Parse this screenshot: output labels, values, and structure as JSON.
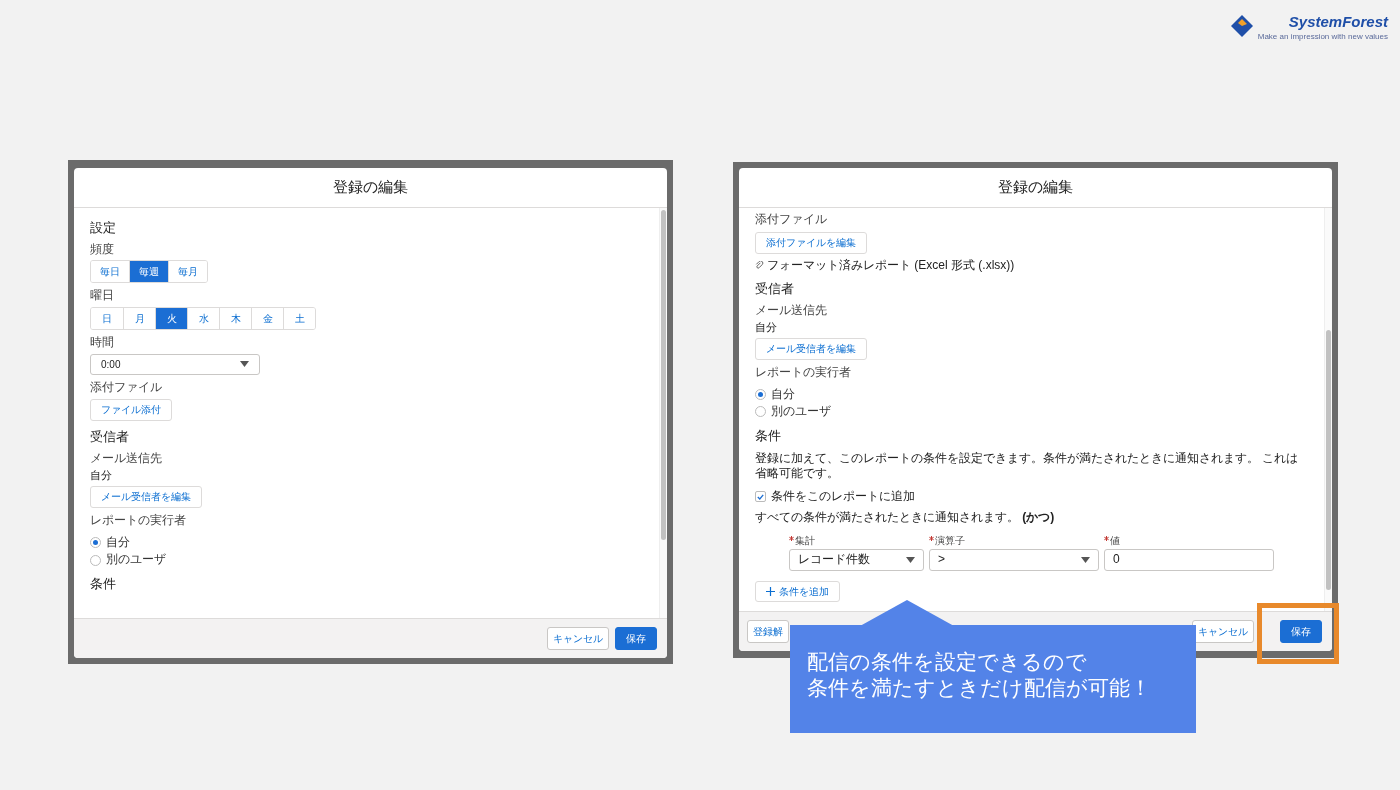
{
  "logo": {
    "name": "SystemForest",
    "tagline": "Make an impression with new values"
  },
  "screenshots": [
    {
      "dialog_title": "登録の編集",
      "items": [
        {
          "kind": "heading",
          "text": "設定"
        },
        {
          "kind": "label",
          "text": "頻度"
        },
        {
          "kind": "segmented",
          "options": [
            {
              "label": "毎日",
              "selected": false
            },
            {
              "label": "毎週",
              "selected": true
            },
            {
              "label": "毎月",
              "selected": false
            }
          ]
        },
        {
          "kind": "label",
          "text": "曜日"
        },
        {
          "kind": "segmented",
          "options": [
            {
              "label": "日",
              "selected": false
            },
            {
              "label": "月",
              "selected": false
            },
            {
              "label": "火",
              "selected": true
            },
            {
              "label": "水",
              "selected": false
            },
            {
              "label": "木",
              "selected": false
            },
            {
              "label": "金",
              "selected": false
            },
            {
              "label": "土",
              "selected": false
            }
          ]
        },
        {
          "kind": "label",
          "text": "時間"
        },
        {
          "kind": "select",
          "value": "0:00"
        },
        {
          "kind": "label",
          "text": "添付ファイル"
        },
        {
          "kind": "button",
          "text": "ファイル添付"
        },
        {
          "kind": "heading",
          "text": "受信者"
        },
        {
          "kind": "label",
          "text": "メール送信先"
        },
        {
          "kind": "value",
          "text": "自分"
        },
        {
          "kind": "button",
          "text": "メール受信者を編集"
        },
        {
          "kind": "label",
          "text": "レポートの実行者"
        },
        {
          "kind": "radios",
          "options": [
            {
              "label": "自分",
              "selected": true
            },
            {
              "label": "別のユーザ",
              "selected": false
            }
          ]
        },
        {
          "kind": "heading",
          "text": "条件"
        }
      ],
      "footer_right": [
        {
          "label": "キャンセル",
          "kind": "neutral"
        },
        {
          "label": "保存",
          "kind": "brand"
        }
      ]
    },
    {
      "dialog_title": "登録の編集",
      "items": [
        {
          "kind": "label",
          "text": "添付ファイル"
        },
        {
          "kind": "button",
          "text": "添付ファイルを編集"
        },
        {
          "kind": "attachment",
          "text": "フォーマット済みレポート (Excel 形式 (.xlsx))"
        },
        {
          "kind": "heading",
          "text": "受信者"
        },
        {
          "kind": "label",
          "text": "メール送信先"
        },
        {
          "kind": "value",
          "text": "自分"
        },
        {
          "kind": "button",
          "text": "メール受信者を編集"
        },
        {
          "kind": "label",
          "text": "レポートの実行者"
        },
        {
          "kind": "radios",
          "options": [
            {
              "label": "自分",
              "selected": true
            },
            {
              "label": "別のユーザ",
              "selected": false
            }
          ]
        },
        {
          "kind": "heading",
          "text": "条件"
        },
        {
          "kind": "paragraph",
          "text": "登録に加えて、このレポートの条件を設定できます。条件が満たされたときに通知されます。 これは省略可能です。"
        },
        {
          "kind": "checkbox",
          "text": "条件をこのレポートに追加",
          "checked": true
        },
        {
          "kind": "paragraph",
          "text": "すべての条件が満たされたときに通知されます。 **(かつ)**"
        },
        {
          "kind": "conditions",
          "fields": [
            {
              "label": "集計",
              "required": true,
              "kind": "select",
              "value": "レコード件数"
            },
            {
              "label": "演算子",
              "required": true,
              "kind": "select",
              "value": ">"
            },
            {
              "label": "値",
              "required": true,
              "kind": "input",
              "value": "0"
            }
          ]
        },
        {
          "kind": "add_button",
          "text": "条件を追加"
        }
      ],
      "footer_left": [
        {
          "label": "登録解",
          "kind": "neutral"
        }
      ],
      "footer_right": [
        {
          "label": "キャンセル",
          "kind": "neutral"
        },
        {
          "label": "保存",
          "kind": "brand"
        }
      ]
    }
  ],
  "callout": {
    "lines": [
      "配信の条件を設定できるので",
      "条件を満たすときだけ配信が可能！"
    ]
  }
}
